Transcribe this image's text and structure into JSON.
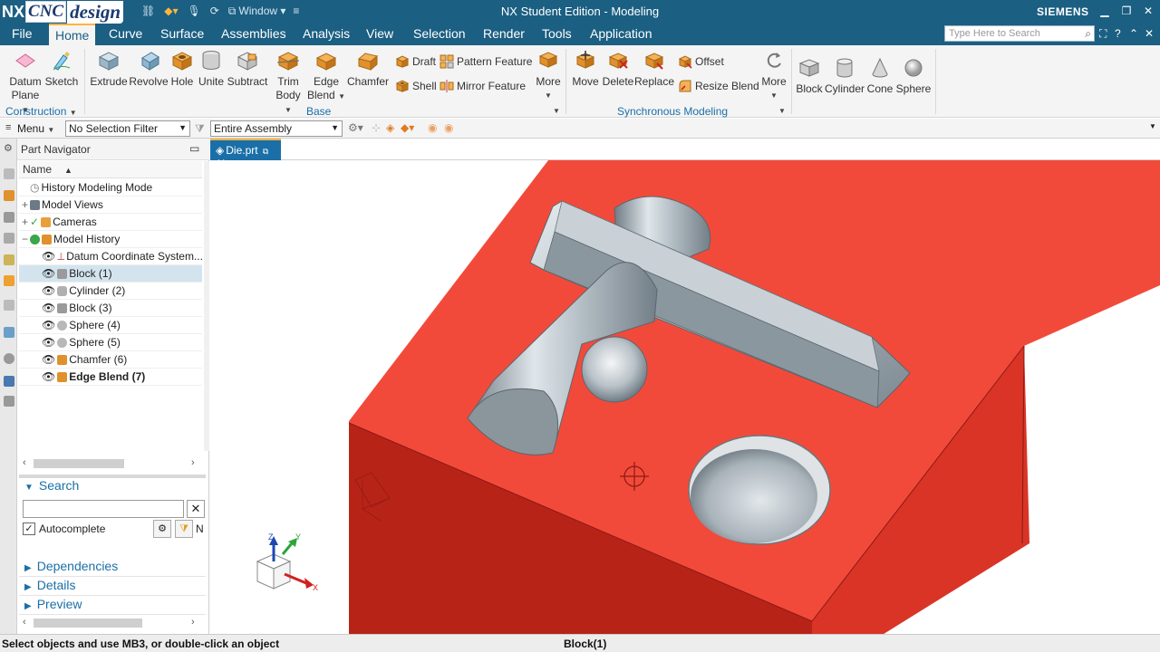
{
  "titlebar": {
    "logo_nx": "NX",
    "logo_cnc": "CNC",
    "logo_design": "design",
    "window_label": "Window",
    "title": "NX Student Edition - Modeling",
    "brand": "SIEMENS"
  },
  "menu": {
    "items": [
      "File",
      "Home",
      "Curve",
      "Surface",
      "Assemblies",
      "Analysis",
      "View",
      "Selection",
      "Render",
      "Tools",
      "Application"
    ],
    "search_placeholder": "Type Here to Search"
  },
  "ribbon": {
    "construction": {
      "datum_plane": [
        "Datum",
        "Plane"
      ],
      "sketch": "Sketch",
      "group": "Construction"
    },
    "base": {
      "extrude": "Extrude",
      "revolve": "Revolve",
      "hole": "Hole",
      "unite": "Unite",
      "subtract": "Subtract",
      "trim_body": [
        "Trim",
        "Body"
      ],
      "edge_blend": [
        "Edge",
        "Blend"
      ],
      "chamfer": "Chamfer",
      "draft": "Draft",
      "shell": "Shell",
      "pattern_feature": "Pattern Feature",
      "mirror_feature": "Mirror Feature",
      "more": "More",
      "group": "Base"
    },
    "sync": {
      "move": "Move",
      "delete": "Delete",
      "replace": "Replace",
      "offset": "Offset",
      "resize_blend": "Resize Blend",
      "more": "More",
      "group": "Synchronous Modeling"
    },
    "primitives": {
      "block": "Block",
      "cylinder": "Cylinder",
      "cone": "Cone",
      "sphere": "Sphere"
    }
  },
  "toolbar": {
    "menu": "Menu",
    "selection_filter": "No Selection Filter",
    "scope": "Entire Assembly"
  },
  "navigator": {
    "title": "Part Navigator",
    "column_name": "Name",
    "rows": [
      "History Modeling Mode",
      "Model Views",
      "Cameras",
      "Model History",
      "Datum Coordinate System...",
      "Block (1)",
      "Cylinder (2)",
      "Block (3)",
      "Sphere (4)",
      "Sphere (5)",
      "Chamfer (6)",
      "Edge Blend (7)"
    ],
    "search_title": "Search",
    "autocomplete": "Autocomplete",
    "n_label": "N",
    "sections": [
      "Dependencies",
      "Details",
      "Preview"
    ]
  },
  "tab": {
    "label": "Die.prt"
  },
  "triad": {
    "z": "Z",
    "y": "Y",
    "x": "X"
  },
  "status": {
    "left": "Select objects and use MB3, or double-click an object",
    "center": "Block(1)"
  },
  "colors": {
    "titlebar": "#1b5f82",
    "accent": "#1b6fa8",
    "block_top": "#f24a3a",
    "block_front": "#b82318",
    "block_side": "#d93426",
    "feature": "#b9c3ca"
  }
}
